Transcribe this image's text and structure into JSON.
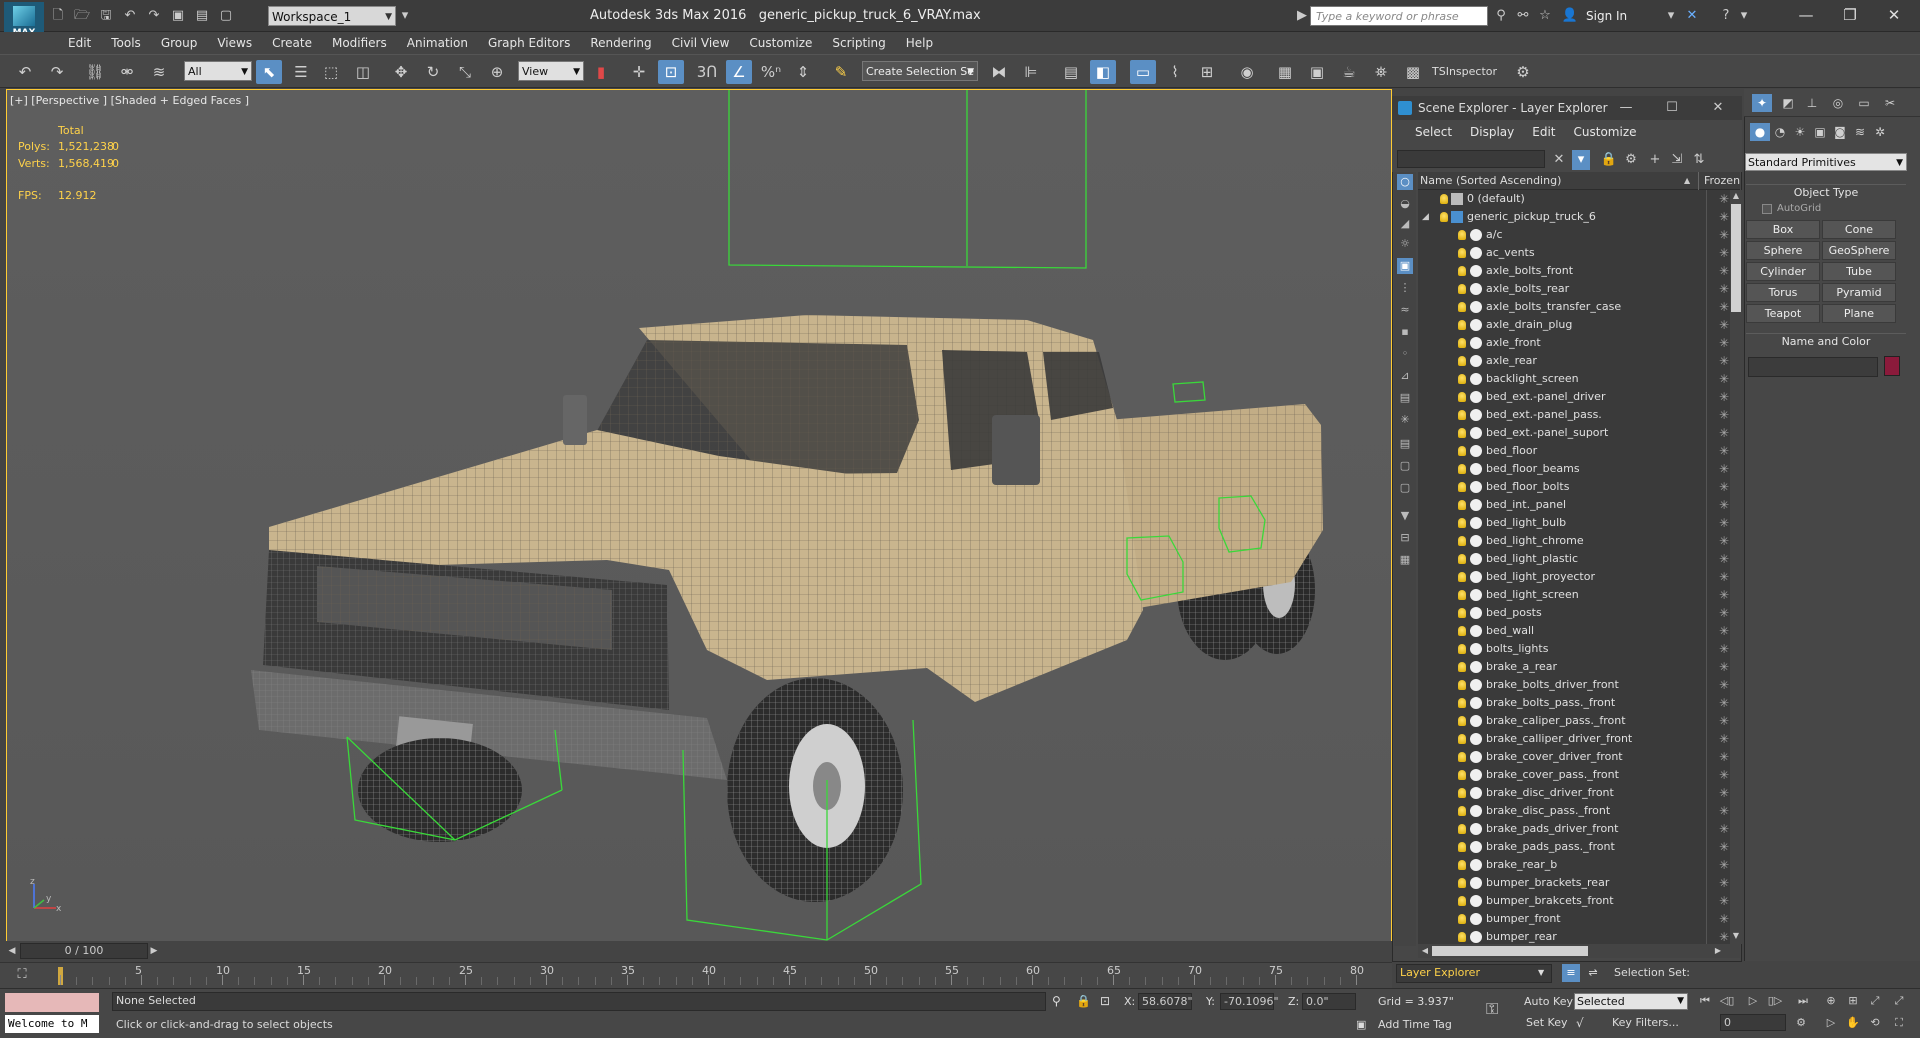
{
  "app": {
    "logo_text": "MAX",
    "title": "Autodesk 3ds Max 2016",
    "file": "generic_pickup_truck_6_VRAY.max",
    "workspace": "Workspace_1",
    "search_placeholder": "Type a keyword or phrase",
    "sign_in": "Sign In"
  },
  "menus": [
    "Edit",
    "Tools",
    "Group",
    "Views",
    "Create",
    "Modifiers",
    "Animation",
    "Graph Editors",
    "Rendering",
    "Civil View",
    "Customize",
    "Scripting",
    "Help"
  ],
  "toolbar": {
    "filter": "All",
    "ref_coord": "View",
    "selection_set": "Create Selection Se",
    "ts_inspector": "TSInspector",
    "snap_3": "3",
    "percent_snap": "%"
  },
  "viewport": {
    "label": "[+] [Perspective ] [Shaded + Edged Faces ]",
    "stats": {
      "total_label": "Total",
      "polys_label": "Polys:",
      "polys_value": "1,521,238",
      "polys_sel": "0",
      "verts_label": "Verts:",
      "verts_value": "1,568,419",
      "verts_sel": "0",
      "fps_label": "FPS:",
      "fps_value": "12.912"
    },
    "axis_z": "z",
    "axis_y": "y",
    "axis_x": "x"
  },
  "scene_explorer": {
    "title": "Scene Explorer - Layer Explorer",
    "menu": [
      "Select",
      "Display",
      "Edit",
      "Customize"
    ],
    "col_name": "Name (Sorted Ascending)",
    "col_frozen": "Frozen",
    "sort_arrow": "▲",
    "layers": [
      {
        "name": "0 (default)",
        "level": 0
      },
      {
        "name": "generic_pickup_truck_6",
        "level": 0,
        "expanded": true
      }
    ],
    "objects": [
      "a/c",
      "ac_vents",
      "axle_bolts_front",
      "axle_bolts_rear",
      "axle_bolts_transfer_case",
      "axle_drain_plug",
      "axle_front",
      "axle_rear",
      "backlight_screen",
      "bed_ext.-panel_driver",
      "bed_ext.-panel_pass.",
      "bed_ext.-panel_suport",
      "bed_floor",
      "bed_floor_beams",
      "bed_floor_bolts",
      "bed_int._panel",
      "bed_light_bulb",
      "bed_light_chrome",
      "bed_light_plastic",
      "bed_light_proyector",
      "bed_light_screen",
      "bed_posts",
      "bed_wall",
      "bolts_lights",
      "brake_a_rear",
      "brake_bolts_driver_front",
      "brake_bolts_pass._front",
      "brake_caliper_pass._front",
      "brake_calliper_driver_front",
      "brake_cover_driver_front",
      "brake_cover_pass._front",
      "brake_disc_driver_front",
      "brake_disc_pass._front",
      "brake_pads_driver_front",
      "brake_pads_pass._front",
      "brake_rear_b",
      "bumper_brackets_rear",
      "bumper_brakcets_front",
      "bumper_front",
      "bumper_rear"
    ],
    "frozen_icon": "✳",
    "footer_label": "Layer Explorer",
    "selection_set_label": "Selection Set:"
  },
  "command_panel": {
    "category": "Standard Primitives",
    "object_type": "Object Type",
    "autogrid": "AutoGrid",
    "primitives": [
      "Box",
      "Cone",
      "Sphere",
      "GeoSphere",
      "Cylinder",
      "Tube",
      "Torus",
      "Pyramid",
      "Teapot",
      "Plane"
    ],
    "name_and_color": "Name and Color",
    "object_color": "#8b1a3b"
  },
  "timeline": {
    "slider_text": "0 / 100",
    "ticks": [
      "0",
      "5",
      "10",
      "15",
      "20",
      "25",
      "30",
      "35",
      "40",
      "45",
      "50",
      "55",
      "60",
      "65",
      "70",
      "75",
      "80"
    ]
  },
  "status": {
    "none_selected": "None Selected",
    "prompt": "Click or click-and-drag to select objects",
    "welcome": "Welcome to M",
    "x_label": "X:",
    "x_value": "58.6078\"",
    "y_label": "Y:",
    "y_value": "-70.1096\"",
    "z_label": "Z:",
    "z_value": "0.0\"",
    "grid": "Grid = 3.937\"",
    "add_time_tag": "Add Time Tag",
    "auto_key": "Auto Key",
    "auto_key_mode": "Selected",
    "set_key": "Set Key",
    "key_filters": "Key Filters...",
    "frame": "0"
  }
}
